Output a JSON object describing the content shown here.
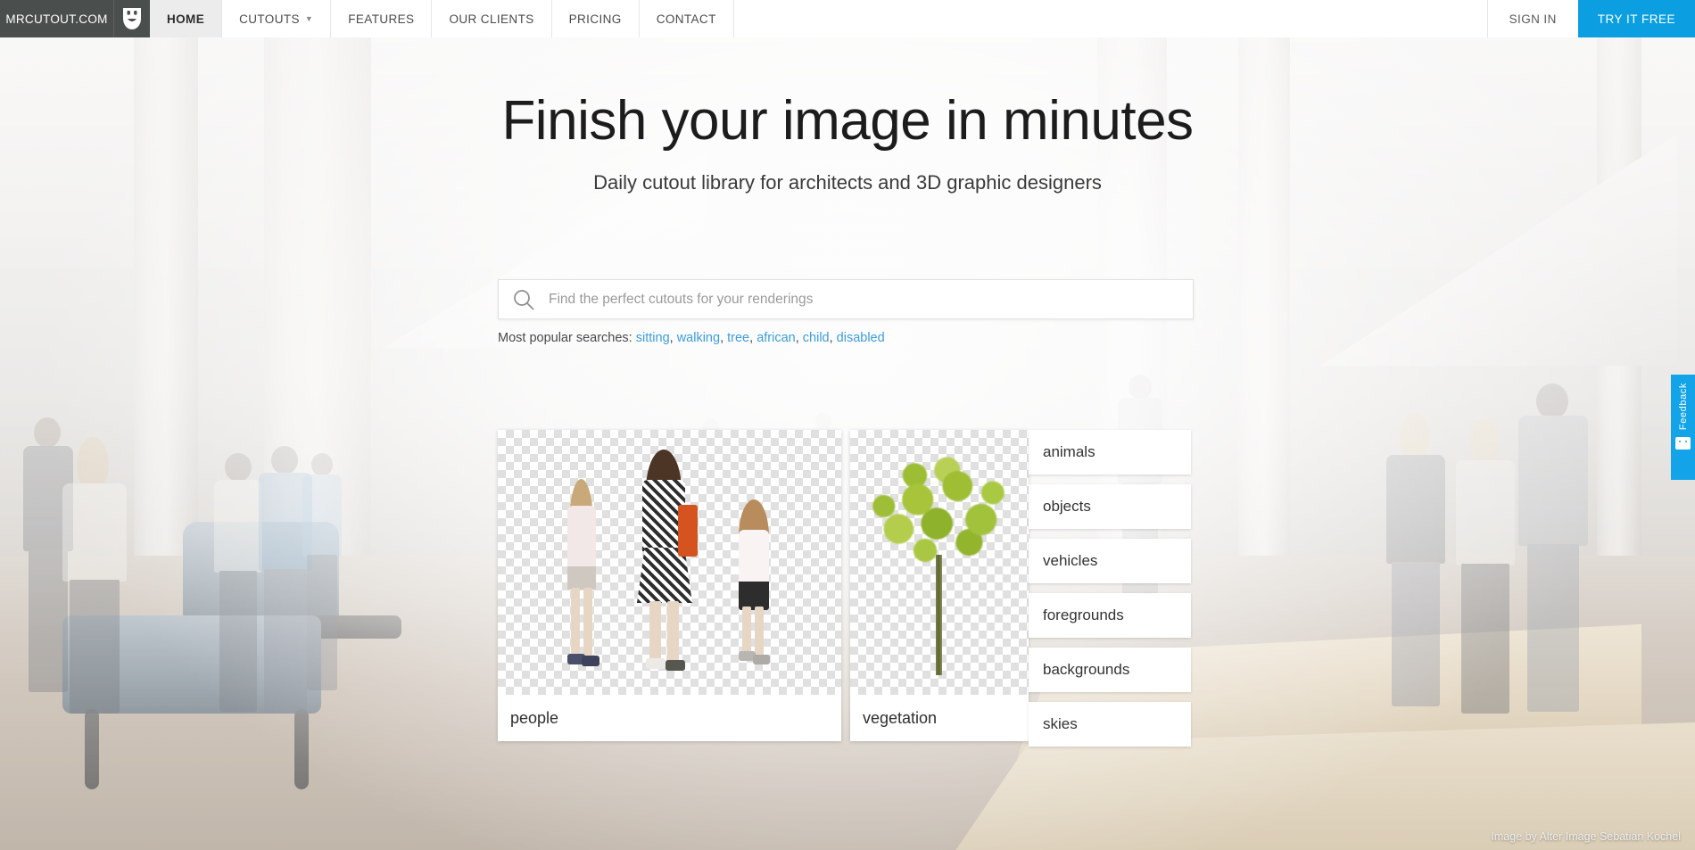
{
  "header": {
    "brand": "MRCUTOUT.COM",
    "logo_icon": "theatre-mask-icon",
    "nav": [
      {
        "label": "HOME",
        "active": true,
        "has_dropdown": false,
        "name": "nav-item-home"
      },
      {
        "label": "CUTOUTS",
        "active": false,
        "has_dropdown": true,
        "name": "nav-item-cutouts"
      },
      {
        "label": "FEATURES",
        "active": false,
        "has_dropdown": false,
        "name": "nav-item-features"
      },
      {
        "label": "OUR CLIENTS",
        "active": false,
        "has_dropdown": false,
        "name": "nav-item-our-clients"
      },
      {
        "label": "PRICING",
        "active": false,
        "has_dropdown": false,
        "name": "nav-item-pricing"
      },
      {
        "label": "CONTACT",
        "active": false,
        "has_dropdown": false,
        "name": "nav-item-contact"
      }
    ],
    "sign_in": "SIGN IN",
    "try_free": "TRY IT FREE",
    "try_free_color": "#0b9fe1"
  },
  "hero": {
    "title": "Finish your image in minutes",
    "subtitle": "Daily cutout library for architects and 3D graphic designers"
  },
  "search": {
    "placeholder": "Find the perfect cutouts for your renderings",
    "value": "",
    "icon": "search-icon",
    "popular_label": "Most popular searches:",
    "popular_terms": [
      "sitting",
      "walking",
      "tree",
      "african",
      "child",
      "disabled"
    ],
    "link_color": "#3a9ede"
  },
  "categories": {
    "cards": [
      {
        "label": "people",
        "name": "category-card-people"
      },
      {
        "label": "vegetation",
        "name": "category-card-vegetation"
      }
    ],
    "list": [
      {
        "label": "animals",
        "name": "category-button-animals"
      },
      {
        "label": "objects",
        "name": "category-button-objects"
      },
      {
        "label": "vehicles",
        "name": "category-button-vehicles"
      },
      {
        "label": "foregrounds",
        "name": "category-button-foregrounds"
      },
      {
        "label": "backgrounds",
        "name": "category-button-backgrounds"
      },
      {
        "label": "skies",
        "name": "category-button-skies"
      }
    ]
  },
  "feedback": {
    "label": "Feedback",
    "icon": "smiley-face-icon",
    "color": "#12a3e8"
  },
  "credit": "Image by Alter Image Sebatian Kochel"
}
